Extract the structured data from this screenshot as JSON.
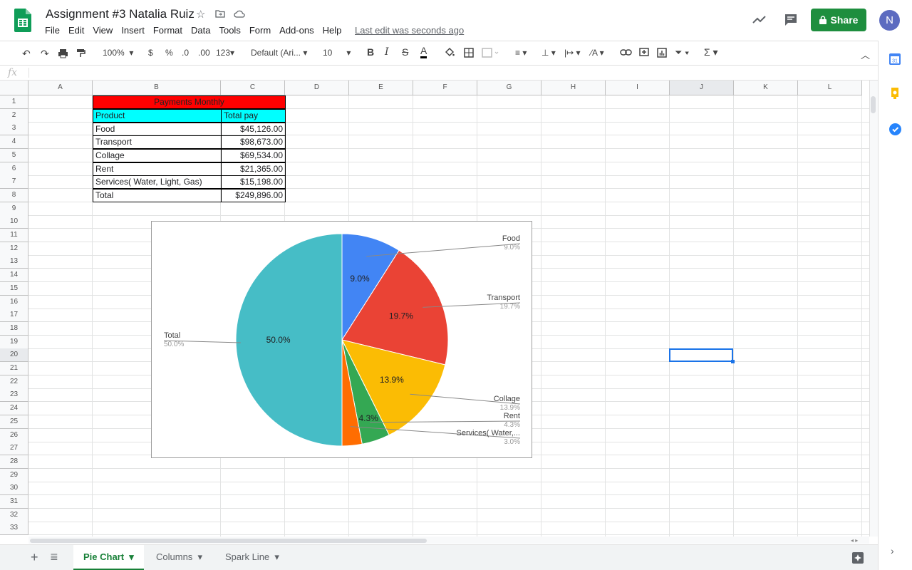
{
  "doc": {
    "title": "Assignment #3 Natalia Ruiz",
    "last_edit": "Last edit was seconds ago"
  },
  "menu": [
    "File",
    "Edit",
    "View",
    "Insert",
    "Format",
    "Data",
    "Tools",
    "Form",
    "Add-ons",
    "Help"
  ],
  "header": {
    "share_label": "Share",
    "avatar_letter": "N"
  },
  "toolbar": {
    "zoom": "100%",
    "currency": "$",
    "percent": "%",
    "dec_less": ".0",
    "dec_more": ".00",
    "number_format": "123",
    "font": "Default (Ari...",
    "font_size": "10"
  },
  "formula": {
    "fx": "fx"
  },
  "columns": [
    "A",
    "B",
    "C",
    "D",
    "E",
    "F",
    "G",
    "H",
    "I",
    "J",
    "K",
    "L"
  ],
  "rows": [
    "1",
    "2",
    "3",
    "4",
    "5",
    "6",
    "7",
    "8",
    "9",
    "10",
    "11",
    "12",
    "13",
    "14",
    "15",
    "16",
    "17",
    "18",
    "19",
    "20",
    "21",
    "22",
    "23",
    "24",
    "25",
    "26",
    "27",
    "28",
    "29",
    "30",
    "31",
    "32",
    "33"
  ],
  "table": {
    "title": "Payments Monthly",
    "headers": [
      "Product",
      "Total pay"
    ],
    "rows": [
      [
        "Food",
        "$45,126.00"
      ],
      [
        "Transport",
        "$98,673.00"
      ],
      [
        "Collage",
        "$69,534.00"
      ],
      [
        "Rent",
        "$21,365.00"
      ],
      [
        "Services( Water, Light, Gas)",
        "$15,198.00"
      ],
      [
        "Total",
        "$249,896.00"
      ]
    ]
  },
  "chart_data": {
    "type": "pie",
    "categories": [
      "Food",
      "Transport",
      "Collage",
      "Rent",
      "Services( Water,...",
      "Total"
    ],
    "values": [
      45126,
      98673,
      69534,
      21365,
      15198,
      249896
    ],
    "percent_labels": [
      "9.0%",
      "19.7%",
      "13.9%",
      "4.3%",
      "3.0%",
      "50.0%"
    ],
    "colors": [
      "#4285f4",
      "#ea4335",
      "#fbbc04",
      "#34a853",
      "#ff6d01",
      "#46bdc6"
    ]
  },
  "sheets": [
    {
      "label": "Pie Chart",
      "active": true
    },
    {
      "label": "Columns",
      "active": false
    },
    {
      "label": "Spark Line",
      "active": false
    }
  ],
  "colors": {
    "title_bg": "#ff0000",
    "header_bg": "#00ffff",
    "share_bg": "#1e8e3e",
    "accent": "#1a73e8"
  }
}
